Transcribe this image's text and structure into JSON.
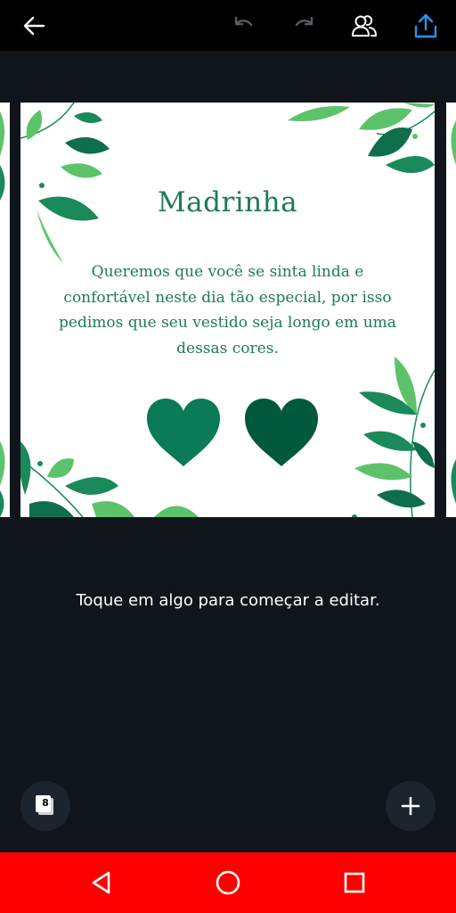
{
  "toolbar": {
    "back_icon": "arrow-left-icon",
    "undo_icon": "undo-icon",
    "redo_icon": "redo-icon",
    "share_people_icon": "people-icon",
    "export_icon": "upload-icon"
  },
  "design": {
    "title": "Madrinha",
    "body_lines": [
      "Queremos que você se sinta linda e",
      "confortável neste dia tão especial, por isso",
      "pedimos que seu vestido seja longo em uma",
      "dessas cores."
    ],
    "swatch_colors": [
      "#0b7a56",
      "#00583d"
    ],
    "leaf_colors": [
      "#1a8a5a",
      "#5cc36a",
      "#0f6e4c"
    ]
  },
  "editor": {
    "hint": "Toque em algo para começar a editar.",
    "pages_count": "8",
    "add_icon": "plus-icon"
  },
  "nav": {
    "back": "triangle-back-icon",
    "home": "circle-home-icon",
    "recents": "square-recents-icon"
  },
  "colors": {
    "topbar": "#000000",
    "background": "#0f151b",
    "accent_blue": "#2196f3",
    "navbar": "#ff0000"
  }
}
